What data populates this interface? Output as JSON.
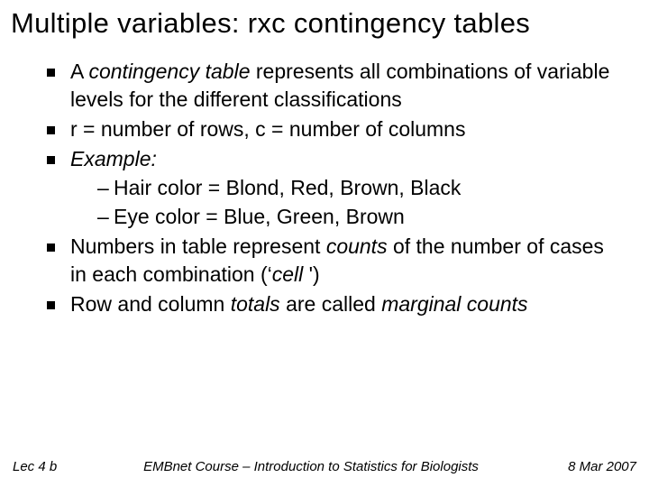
{
  "title": "Multiple variables: rxc contingency tables",
  "bullets": {
    "b1_pre": "A ",
    "b1_em": "contingency table",
    "b1_post": " represents all combinations of variable levels for the different classifications",
    "b2": "r = number of rows, c = number of columns",
    "b3": "Example:",
    "b3_sub1": "Hair color = Blond, Red, Brown, Black",
    "b3_sub2": "Eye color = Blue, Green, Brown",
    "b4_pre": "Numbers in table represent ",
    "b4_em": "counts",
    "b4_post": " of the number of cases in each combination (‘",
    "b4_em2": "cell ",
    "b4_post2": "')",
    "b5_pre": "Row and column ",
    "b5_em": "totals",
    "b5_post": " are called ",
    "b5_em2": "marginal counts"
  },
  "footer": {
    "left": "Lec 4 b",
    "center": "EMBnet Course – Introduction to Statistics for Biologists",
    "right": "8 Mar 2007"
  }
}
